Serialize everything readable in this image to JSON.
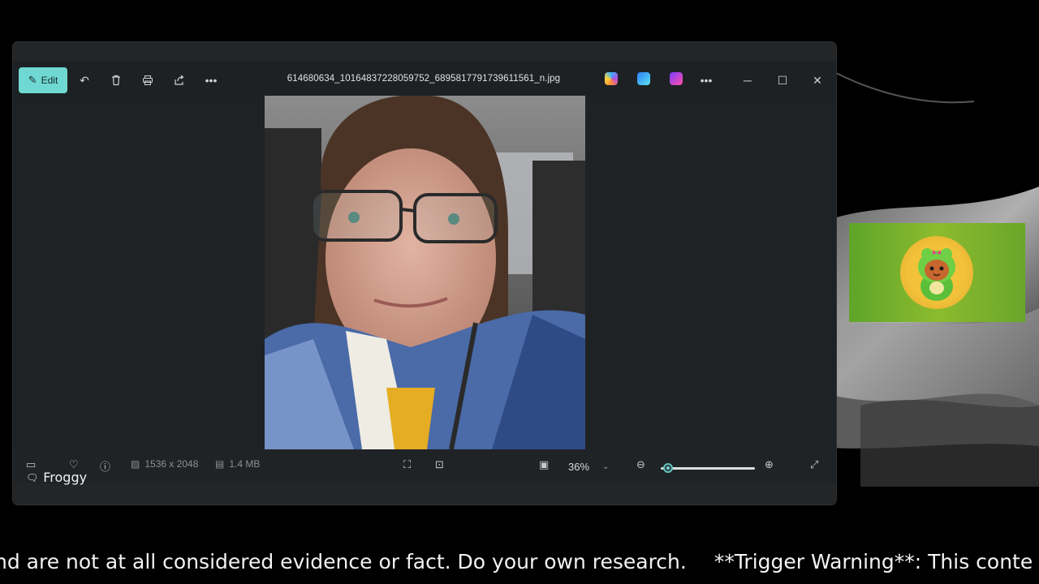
{
  "window": {
    "filename": "614680634_10164837228059752_6895817791739611561_n.jpg",
    "edit_label": "Edit"
  },
  "toolbar_icons": [
    "edit-icon",
    "rotate-icon",
    "delete-icon",
    "print-icon",
    "share-icon",
    "more-icon"
  ],
  "app_icons": [
    "copilot-icon",
    "designer-icon",
    "clipchamp-icon"
  ],
  "bottom_bar": {
    "dimensions": "1536 x 2048",
    "file_size": "1.4 MB",
    "zoom": "36%"
  },
  "zoom_slider_level": 0.08,
  "overlay_label": "Froggy",
  "ticker": {
    "segment_1": "nd are not at all considered evidence or fact. Do your own research.",
    "segment_2": "**Trigger Warning**: This conte"
  },
  "colors": {
    "edit_accent": "#6fd8d2",
    "window_bg": "#1f2224",
    "avatar_bg": "#7fb32c"
  }
}
